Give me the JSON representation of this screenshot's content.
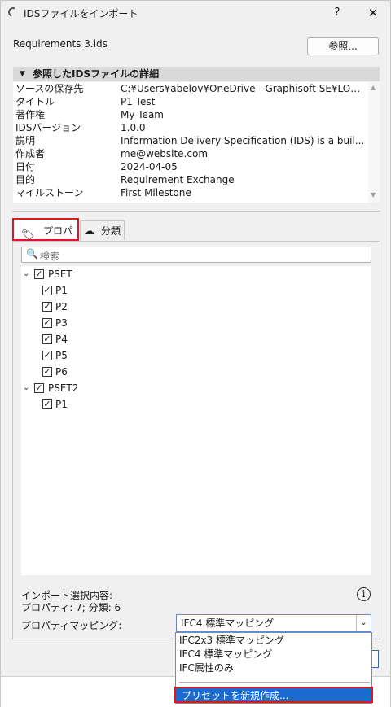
{
  "window": {
    "title": "IDSファイルをインポート",
    "help_label": "?",
    "close_label": "✕"
  },
  "file": {
    "name": "Requirements 3.ids",
    "browse_label": "参照..."
  },
  "details": {
    "header": "参照したIDSファイルの詳細",
    "rows": [
      {
        "key": "ソースの保存先",
        "value": "C:¥Users¥abelov¥OneDrive - Graphisoft SE¥LOC ..."
      },
      {
        "key": "タイトル",
        "value": "P1 Test"
      },
      {
        "key": "著作権",
        "value": "My Team"
      },
      {
        "key": "IDSバージョン",
        "value": "1.0.0"
      },
      {
        "key": "説明",
        "value": "Information Delivery Specification (IDS) is a buil..."
      },
      {
        "key": "作成者",
        "value": "me@website.com"
      },
      {
        "key": "日付",
        "value": "2024-04-05"
      },
      {
        "key": "目的",
        "value": "Requirement Exchange"
      },
      {
        "key": "マイルストーン",
        "value": "First Milestone"
      }
    ]
  },
  "tabs": {
    "properties": "プロパティ",
    "classification": "分類"
  },
  "search": {
    "placeholder": "検索"
  },
  "tree": {
    "groups": [
      {
        "label": "PSET",
        "items": [
          "P1",
          "P2",
          "P3",
          "P4",
          "P5",
          "P6"
        ]
      },
      {
        "label": "PSET2",
        "items": [
          "P1"
        ]
      }
    ]
  },
  "summary": {
    "line1": "インポート選択内容:",
    "line2": "プロパティ: 7; 分類: 6"
  },
  "mapping": {
    "label": "プロパティマッピング:",
    "selected": "IFC4 標準マッピング",
    "options": [
      "IFC2x3 標準マッピング",
      "IFC4 標準マッピング",
      "IFC属性のみ"
    ],
    "new_preset": "プリセットを新規作成..."
  }
}
